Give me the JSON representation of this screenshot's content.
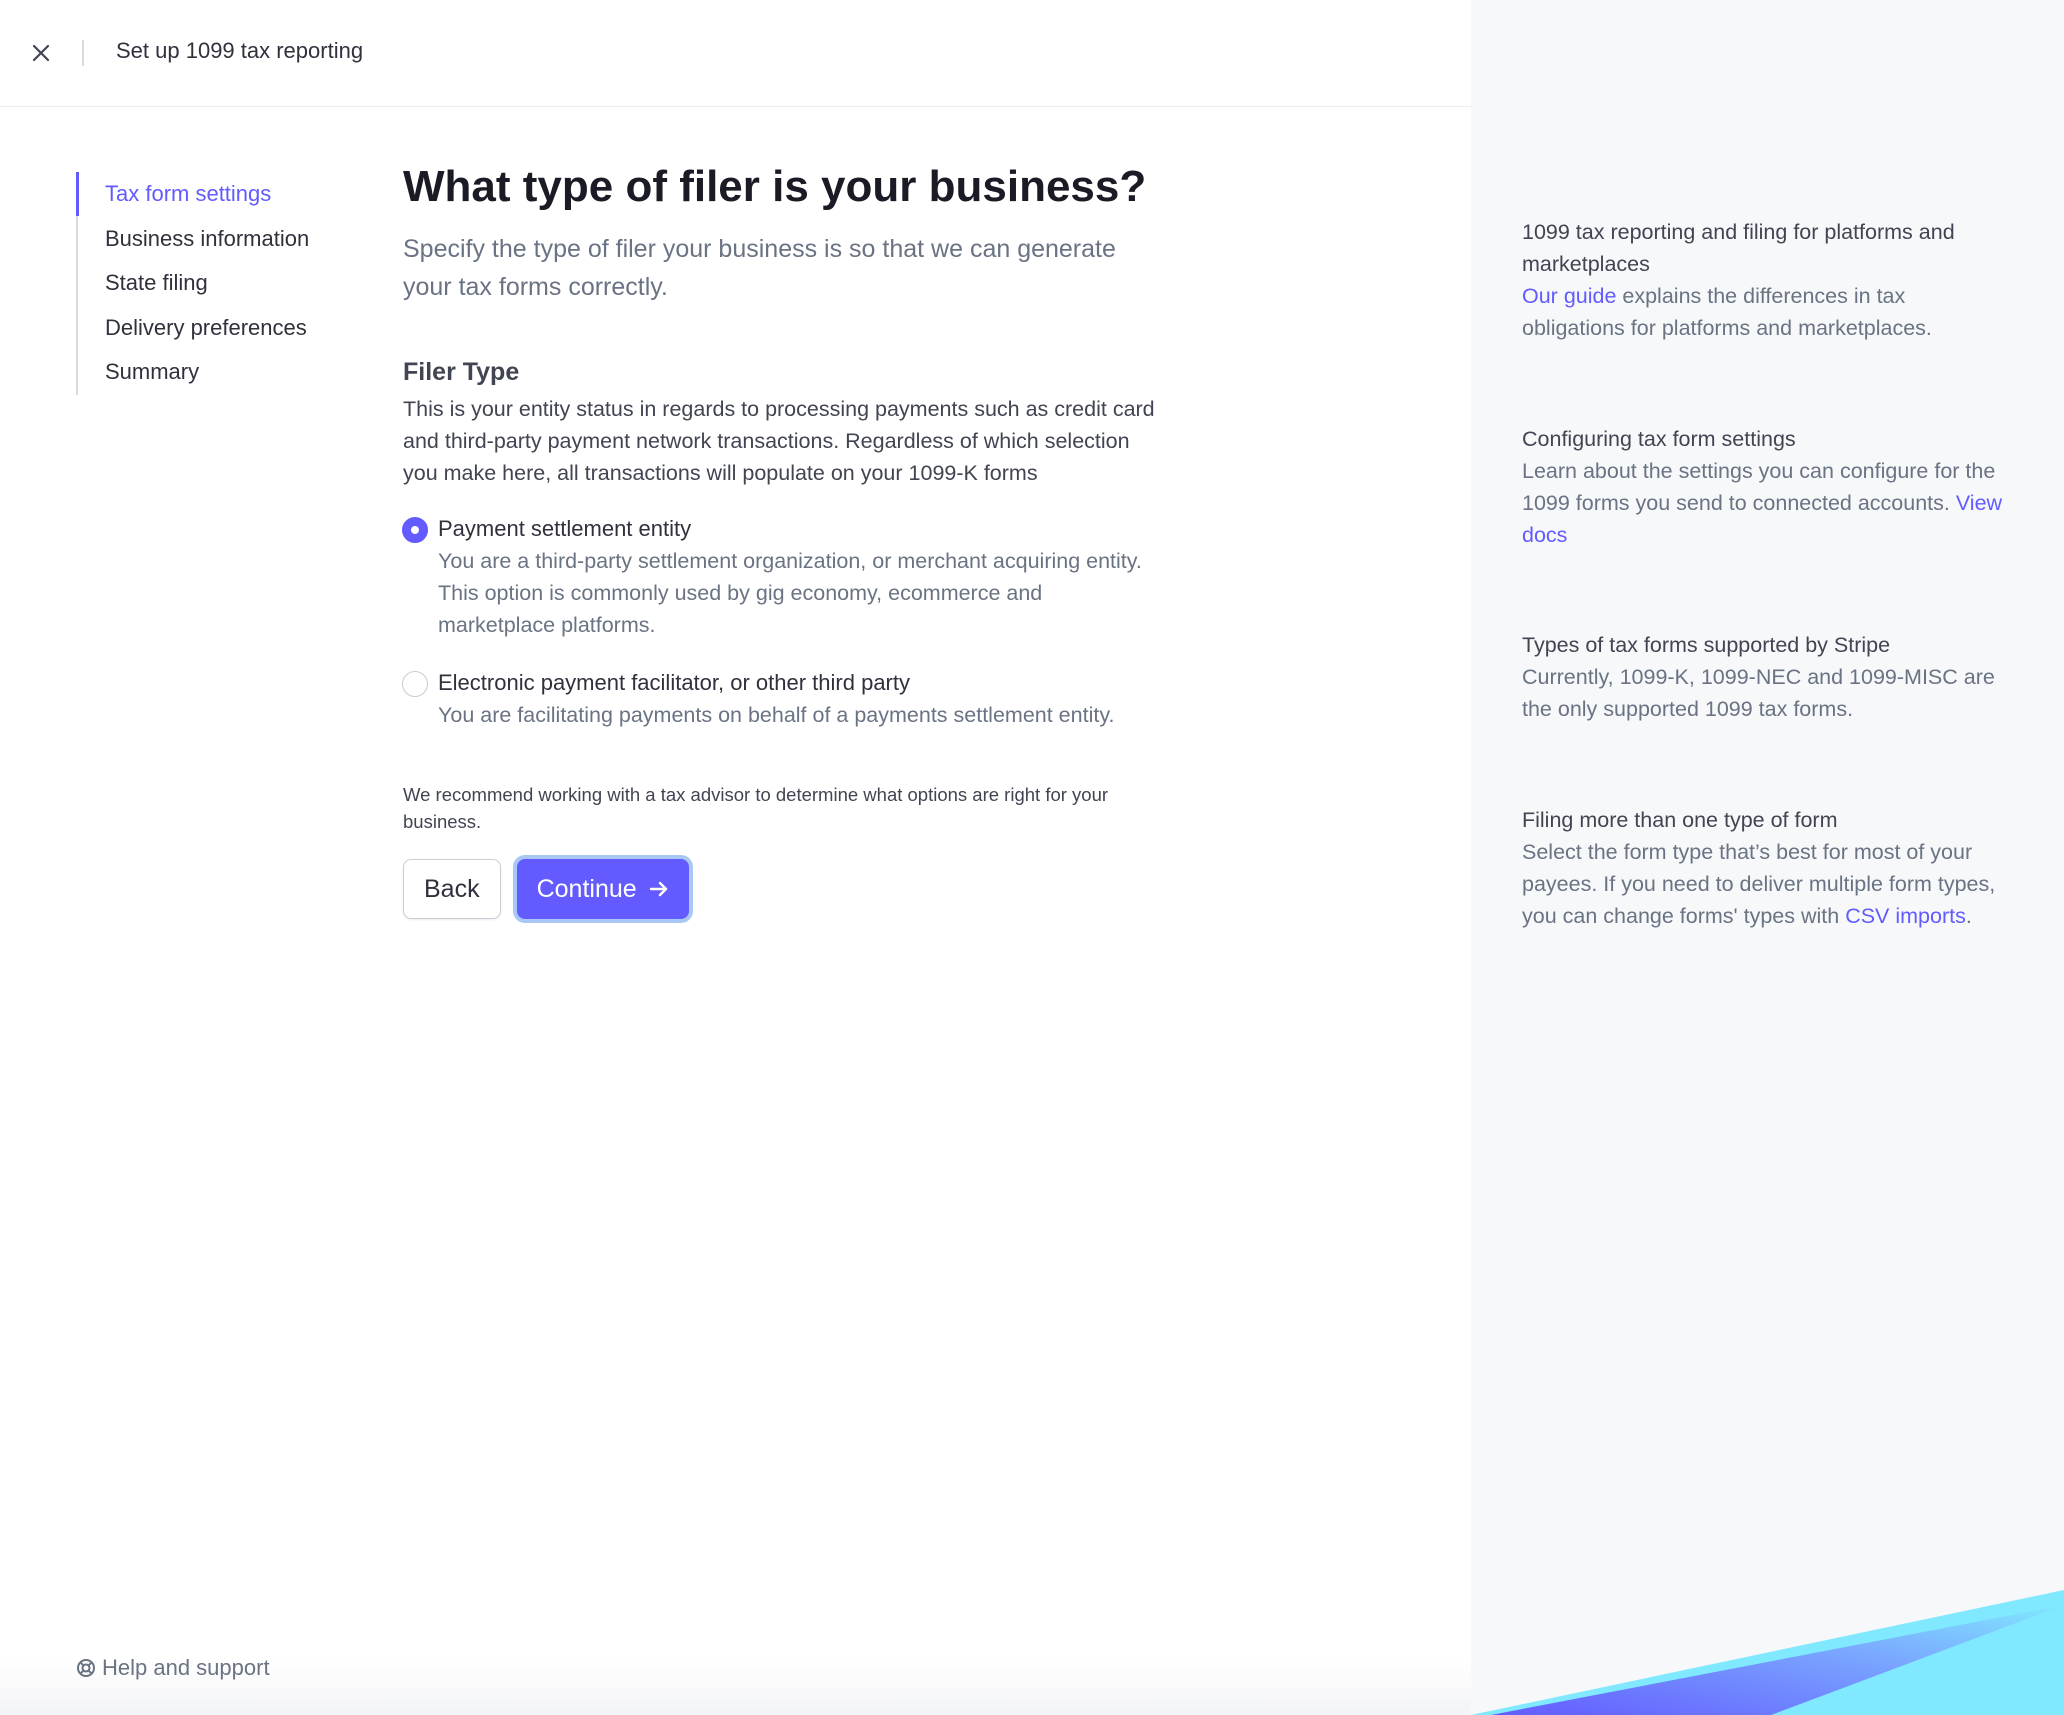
{
  "topbar": {
    "close_icon": "close-icon",
    "title": "Set up 1099 tax reporting"
  },
  "steps": [
    {
      "label": "Tax form settings",
      "active": true
    },
    {
      "label": "Business information"
    },
    {
      "label": "State filing"
    },
    {
      "label": "Delivery preferences"
    },
    {
      "label": "Summary"
    }
  ],
  "main": {
    "title": "What type of filer is your business?",
    "subtitle": "Specify the type of filer your business is so that we can generate your tax forms correctly.",
    "section_title": "Filer Type",
    "section_desc": "This is your entity status in regards to processing payments such as credit card and third-party payment network transactions. Regardless of which selection you make here, all transactions will populate on your 1099-K forms",
    "options": [
      {
        "label": "Payment settlement entity",
        "desc": "You are a third-party settlement organization, or merchant acquiring entity. This option is commonly used by gig economy, ecommerce and marketplace platforms.",
        "selected": true
      },
      {
        "label": "Electronic payment facilitator, or other third party",
        "desc": "You are facilitating payments on behalf of a payments settlement entity.",
        "selected": false
      }
    ],
    "advice": "We recommend working with a tax advisor to determine what options are right for your business.",
    "back_label": "Back",
    "continue_label": "Continue",
    "continue_icon": "arrow-right-icon"
  },
  "help": {
    "icon": "lifebuoy-icon",
    "label": "Help and support"
  },
  "aside": [
    {
      "title": "1099 tax reporting and filing for platforms and marketplaces",
      "link": "Our guide",
      "body": " explains the differences in tax obligations for platforms and marketplaces."
    },
    {
      "title": "Configuring tax form settings",
      "body": "Learn about the settings you can configure for the 1099 forms you send to connected accounts. ",
      "link": "View docs"
    },
    {
      "title": "Types of tax forms supported by Stripe",
      "body": "Currently, 1099-K, 1099-NEC and 1099-MISC are the only supported 1099 tax forms."
    },
    {
      "title": "Filing more than one type of form",
      "body": "Select the form type that’s best for most of your payees. If you need to deliver multiple form types, you can change forms' types with ",
      "link": "CSV imports",
      "tail": "."
    }
  ],
  "colors": {
    "accent": "#635bff",
    "aside_bg": "#f6f8fa",
    "deco_cyan": "#80e9ff",
    "deco_blue": "#635bff"
  }
}
